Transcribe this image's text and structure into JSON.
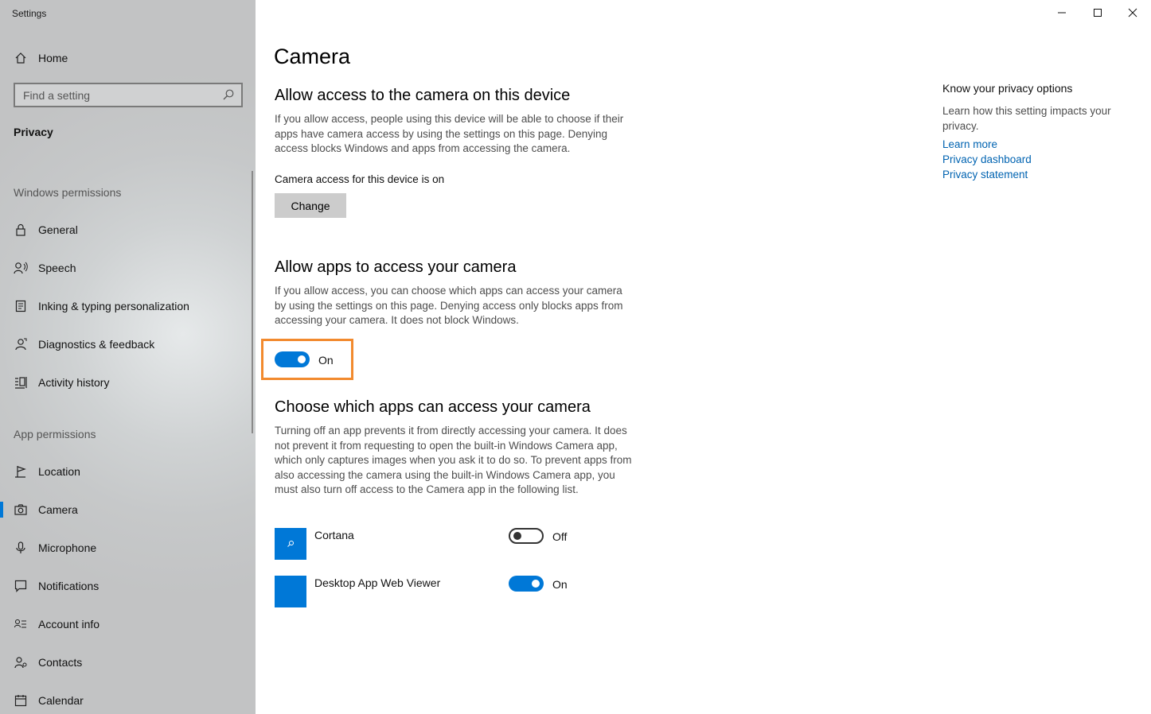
{
  "window": {
    "title": "Settings",
    "controls": [
      "minimize",
      "maximize",
      "close"
    ]
  },
  "sidebar": {
    "home_label": "Home",
    "search_placeholder": "Find a setting",
    "category": "Privacy",
    "windows_permissions_header": "Windows permissions",
    "windows_permissions": [
      {
        "label": "General",
        "icon": "lock-icon"
      },
      {
        "label": "Speech",
        "icon": "speech-icon"
      },
      {
        "label": "Inking & typing personalization",
        "icon": "inking-icon"
      },
      {
        "label": "Diagnostics & feedback",
        "icon": "diagnostics-icon"
      },
      {
        "label": "Activity history",
        "icon": "activity-icon"
      }
    ],
    "app_permissions_header": "App permissions",
    "app_permissions": [
      {
        "label": "Location",
        "icon": "location-icon"
      },
      {
        "label": "Camera",
        "icon": "camera-icon",
        "selected": true
      },
      {
        "label": "Microphone",
        "icon": "microphone-icon"
      },
      {
        "label": "Notifications",
        "icon": "notifications-icon"
      },
      {
        "label": "Account info",
        "icon": "account-info-icon"
      },
      {
        "label": "Contacts",
        "icon": "contacts-icon"
      },
      {
        "label": "Calendar",
        "icon": "calendar-icon"
      }
    ]
  },
  "main": {
    "title": "Camera",
    "device_section": {
      "heading": "Allow access to the camera on this device",
      "description": "If you allow access, people using this device will be able to choose if their apps have camera access by using the settings on this page. Denying access blocks Windows and apps from accessing the camera.",
      "status": "Camera access for this device is on",
      "button_label": "Change"
    },
    "apps_section": {
      "heading": "Allow apps to access your camera",
      "description": "If you allow access, you can choose which apps can access your camera by using the settings on this page. Denying access only blocks apps from accessing your camera. It does not block Windows.",
      "toggle_state": "On"
    },
    "choose_section": {
      "heading": "Choose which apps can access your camera",
      "description": "Turning off an app prevents it from directly accessing your camera. It does not prevent it from requesting to open the built-in Windows Camera app, which only captures images when you ask it to do so. To prevent apps from also accessing the camera using the built-in Windows Camera app, you must also turn off access to the Camera app in the following list.",
      "apps": [
        {
          "name": "Cortana",
          "state": "Off"
        },
        {
          "name": "Desktop App Web Viewer",
          "state": "On"
        }
      ]
    }
  },
  "right_column": {
    "title": "Know your privacy options",
    "description": "Learn how this setting impacts your privacy.",
    "links": [
      "Learn more",
      "Privacy dashboard",
      "Privacy statement"
    ]
  },
  "colors": {
    "accent": "#0078d7",
    "highlight": "#f28a2e",
    "link": "#0063b1"
  }
}
